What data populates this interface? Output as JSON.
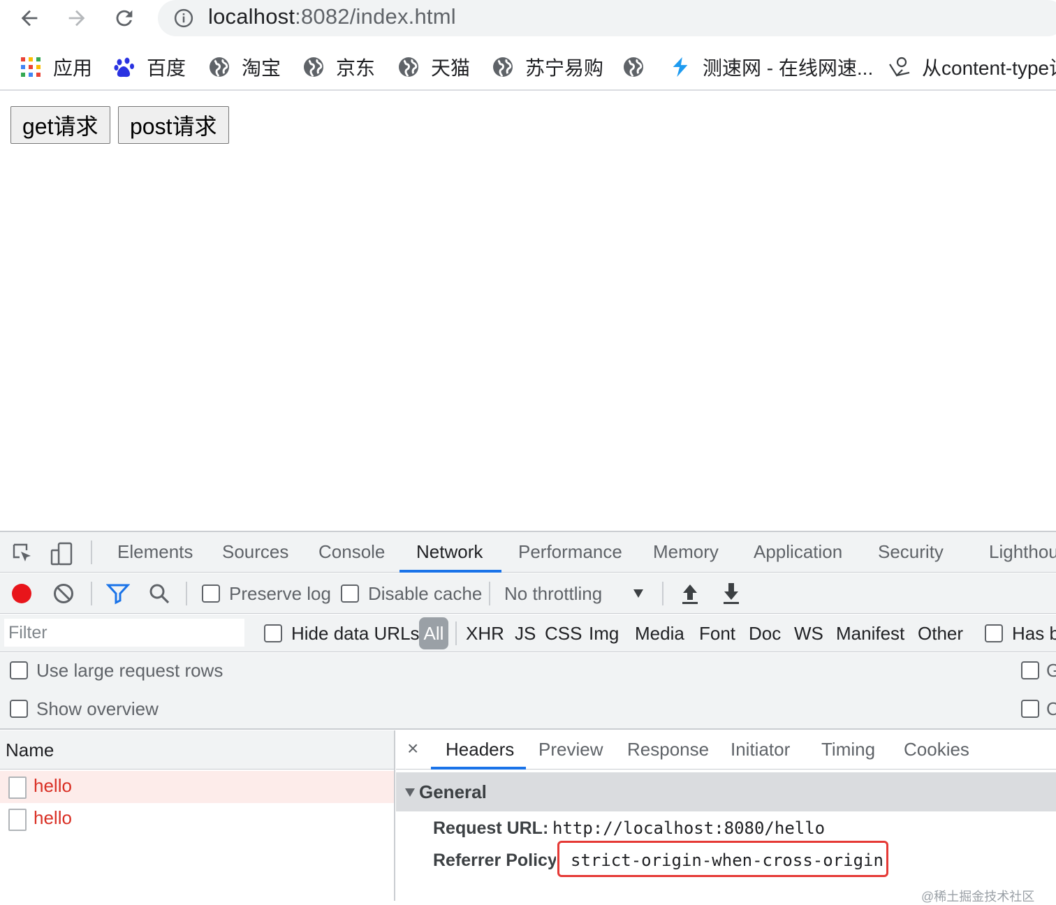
{
  "browser": {
    "url_host": "localhost",
    "url_rest": ":8082/index.html",
    "bookmarks": [
      {
        "label": "应用",
        "icon": "apps-grid-icon"
      },
      {
        "label": "百度",
        "icon": "baidu-paw-icon"
      },
      {
        "label": "淘宝",
        "icon": "globe-icon"
      },
      {
        "label": "京东",
        "icon": "globe-icon"
      },
      {
        "label": "天猫",
        "icon": "globe-icon"
      },
      {
        "label": "苏宁易购",
        "icon": "globe-icon"
      },
      {
        "label": "",
        "icon": "globe-icon"
      },
      {
        "label": "测速网 - 在线网速...",
        "icon": "speedtest-icon"
      },
      {
        "label": "从content-type设",
        "icon": "juejin-icon"
      }
    ]
  },
  "page": {
    "buttons": [
      "get请求",
      "post请求"
    ]
  },
  "devtools": {
    "tabs": [
      "Elements",
      "Sources",
      "Console",
      "Network",
      "Performance",
      "Memory",
      "Application",
      "Security",
      "Lighthouse"
    ],
    "active_tab": "Network",
    "toolbar": {
      "preserve_log": "Preserve log",
      "disable_cache": "Disable cache",
      "throttling": "No throttling"
    },
    "filter": {
      "placeholder": "Filter",
      "hide_data_urls": "Hide data URLs",
      "all": "All",
      "types": [
        "XHR",
        "JS",
        "CSS",
        "Img",
        "Media",
        "Font",
        "Doc",
        "WS",
        "Manifest",
        "Other"
      ],
      "has_blocked": "Has b"
    },
    "settings": {
      "large_rows": "Use large request rows",
      "show_overview": "Show overview",
      "right_1": "G",
      "right_2": "C"
    },
    "requests": {
      "header": "Name",
      "rows": [
        "hello",
        "hello"
      ]
    },
    "details": {
      "close": "×",
      "tabs": [
        "Headers",
        "Preview",
        "Response",
        "Initiator",
        "Timing",
        "Cookies"
      ],
      "active_tab": "Headers",
      "section": "General",
      "request_url_label": "Request URL:",
      "request_url": "http://localhost:8080/hello",
      "referrer_policy_label": "Referrer Policy:",
      "referrer_policy": "strict-origin-when-cross-origin"
    }
  },
  "watermark": "@稀土掘金技术社区",
  "colors": {
    "accent": "#1a73e8",
    "error_text": "#d93025",
    "record": "#e8151b",
    "highlight_box": "#e53935"
  }
}
